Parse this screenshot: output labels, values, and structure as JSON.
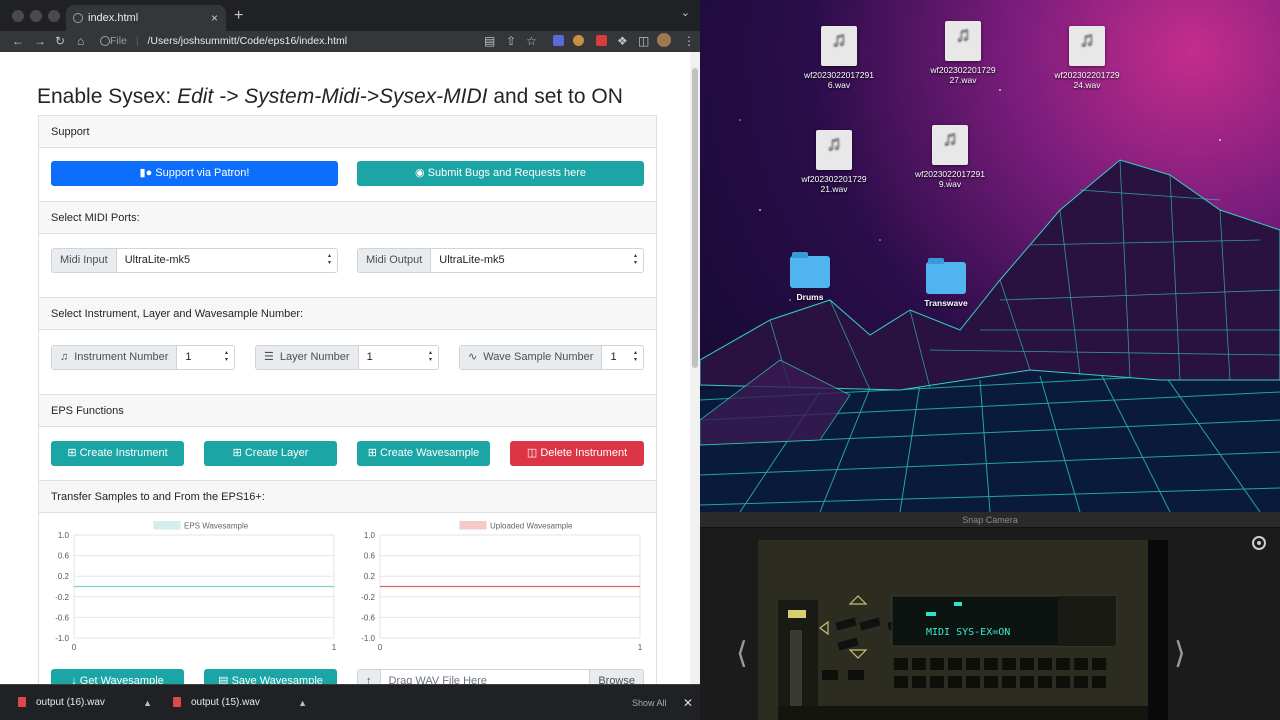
{
  "browser": {
    "tab_title": "index.html",
    "tab_close": "×",
    "new_tab": "+",
    "tab_menu": "⌄",
    "address_prefix": "File",
    "address": "/Users/joshsummitt/Code/eps16/index.html"
  },
  "page": {
    "heading_plain": "Enable Sysex: ",
    "heading_italic": "Edit -> System-Midi->Sysex-MIDI",
    "heading_tail": " and set to ON",
    "support": {
      "header": "Support",
      "patron_label": "Support via Patron!",
      "bugs_label": "Submit Bugs and Requests here"
    },
    "midi": {
      "header": "Select MIDI Ports:",
      "input_label": "Midi Input",
      "input_value": "UltraLite-mk5",
      "output_label": "Midi Output",
      "output_value": "UltraLite-mk5"
    },
    "select": {
      "header": "Select Instrument, Layer and Wavesample Number:",
      "instrument_label": "Instrument Number",
      "instrument_value": "1",
      "layer_label": "Layer Number",
      "layer_value": "1",
      "wave_label": "Wave Sample Number",
      "wave_value": "1"
    },
    "functions": {
      "header": "EPS Functions",
      "create_instrument": "Create Instrument",
      "create_layer": "Create Layer",
      "create_wavesample": "Create Wavesample",
      "delete_instrument": "Delete Instrument"
    },
    "transfer": {
      "header": "Transfer Samples to and From the EPS16+:",
      "get_wavesample": "Get Wavesample",
      "save_wavesample": "Save Wavesample",
      "drag_placeholder": "Drag WAV File Here",
      "browse": "Browse"
    }
  },
  "chart_data": [
    {
      "type": "line",
      "series": [
        {
          "name": "EPS Wavesample",
          "color": "#7fcfcf",
          "x": [
            0,
            1
          ],
          "y": [
            0,
            0
          ]
        }
      ],
      "yticks": [
        "1.0",
        "0.6",
        "0.2",
        "-0.2",
        "-0.6",
        "-1.0"
      ],
      "xticks": [
        "0",
        "1"
      ],
      "ylim": [
        -1,
        1
      ],
      "xlim": [
        0,
        1
      ],
      "legend": "top"
    },
    {
      "type": "line",
      "series": [
        {
          "name": "Uploaded Wavesample",
          "color": "#e06666",
          "x": [
            0,
            1
          ],
          "y": [
            0,
            0
          ]
        }
      ],
      "yticks": [
        "1.0",
        "0.6",
        "0.2",
        "-0.2",
        "-0.6",
        "-1.0"
      ],
      "xticks": [
        "0",
        "1"
      ],
      "ylim": [
        -1,
        1
      ],
      "xlim": [
        0,
        1
      ],
      "legend": "top"
    }
  ],
  "desktop": {
    "files": [
      {
        "name": "wf2023022017291\n6.wav"
      },
      {
        "name": "wf202302201729\n27.wav"
      },
      {
        "name": "wf202302201729\n24.wav"
      },
      {
        "name": "wf202302201729\n21.wav"
      },
      {
        "name": "wf2023022017291\n9.wav"
      }
    ],
    "folders": [
      {
        "name": "Drums"
      },
      {
        "name": "Transwave"
      }
    ]
  },
  "snap": {
    "title": "Snap Camera",
    "display_text": "MIDI SYS-EX=ON",
    "prev": "⟨",
    "next": "⟩"
  },
  "downloads": {
    "items": [
      {
        "name": "output (16).wav"
      },
      {
        "name": "output (15).wav"
      }
    ],
    "show_all": "Show All",
    "close": "✕"
  }
}
